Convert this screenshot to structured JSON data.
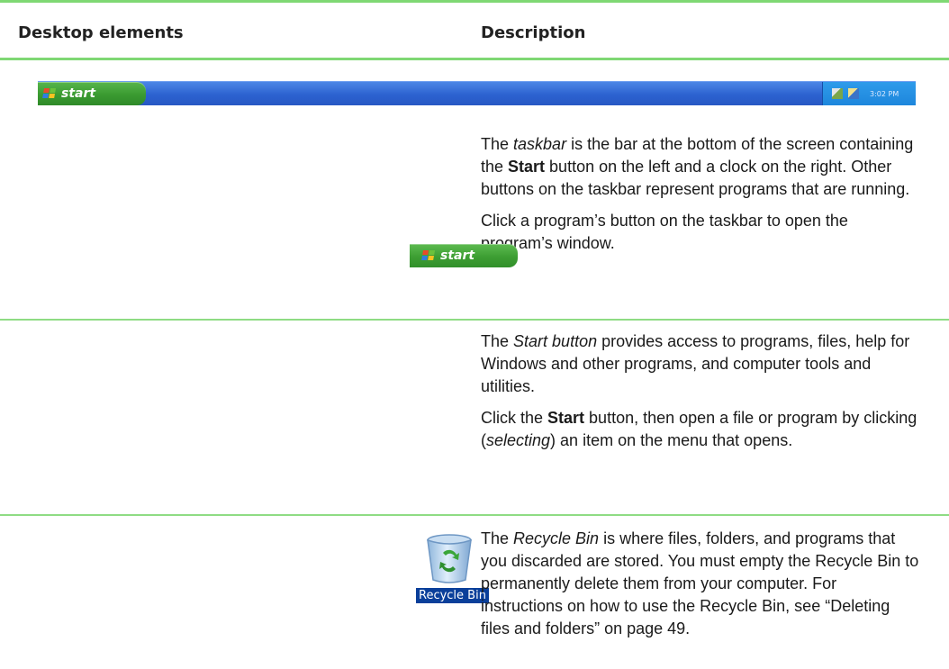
{
  "header": {
    "col_left": "Desktop elements",
    "col_right": "Description"
  },
  "taskbar_graphic": {
    "start_label": "start",
    "clock_text": "3:02 PM"
  },
  "start_graphic": {
    "label": "start"
  },
  "recycle_graphic": {
    "label": "Recycle Bin"
  },
  "rows": [
    {
      "p1": {
        "a": "The ",
        "term": "taskbar",
        "b": " is the bar at the bottom of the screen containing the ",
        "bold": "Start",
        "c": " button on the left and a clock on the right. Other buttons on the taskbar represent programs that are running."
      },
      "p2": "Click a program’s button on the taskbar to open the program’s window."
    },
    {
      "p1": {
        "a": "The ",
        "term": "Start button",
        "b": " provides access to programs, files, help for Windows and other programs, and computer tools and utilities."
      },
      "p2": {
        "a": "Click the ",
        "bold": "Start",
        "b": " button, then open a file or program by clicking (",
        "term": "selecting",
        "c": ") an item on the menu that opens."
      }
    },
    {
      "p1": {
        "a": "The ",
        "term": "Recycle Bin",
        "b": " is where files, folders, and programs that you discarded are stored. You must empty the Recycle Bin to permanently delete them from your computer. For instructions on how to use the Recycle Bin, see “Deleting files and folders” on page 49."
      }
    }
  ]
}
